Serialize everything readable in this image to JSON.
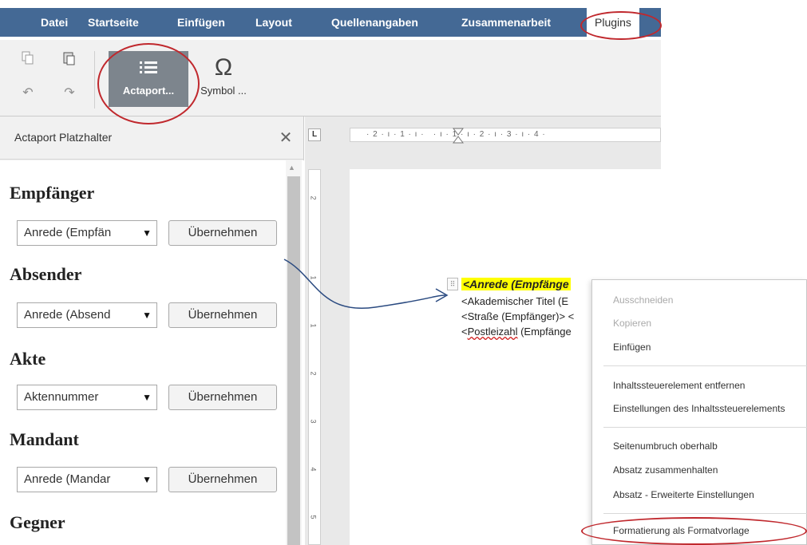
{
  "menubar": {
    "tabs": [
      {
        "label": "Datei"
      },
      {
        "label": "Startseite"
      },
      {
        "label": "Einfügen"
      },
      {
        "label": "Layout"
      },
      {
        "label": "Quellenangaben"
      },
      {
        "label": "Zusammenarbeit"
      },
      {
        "label": "Plugins"
      }
    ],
    "active_tab": "Plugins"
  },
  "toolbar": {
    "copy_icon": "copy-icon",
    "paste_icon": "paste-icon",
    "undo_icon": "undo-icon",
    "redo_icon": "redo-icon",
    "actaport_label": "Actaport...",
    "actaport_icon": "list-icon",
    "symbol_label": "Symbol ...",
    "symbol_icon": "omega-icon"
  },
  "panel": {
    "title": "Actaport Platzhalter",
    "sections": [
      {
        "title": "Empfänger",
        "select": "Anrede (Empfän",
        "button": "Übernehmen"
      },
      {
        "title": "Absender",
        "select": "Anrede (Absend",
        "button": "Übernehmen"
      },
      {
        "title": "Akte",
        "select": "Aktennummer",
        "button": "Übernehmen"
      },
      {
        "title": "Mandant",
        "select": "Anrede (Mandar",
        "button": "Übernehmen"
      },
      {
        "title": "Gegner"
      }
    ]
  },
  "document": {
    "ruler_corner": "L",
    "hruler_marks": "· 2 · ı · 1 · ı ·   · ı · 1 · ı · 2 · ı · 3 · ı · 4 ·",
    "vruler_marks": [
      "2",
      "1",
      "1",
      "2",
      "3",
      "4",
      "5"
    ],
    "lines": [
      "<Anrede (Empfänge",
      "<Akademischer Titel (E",
      "<Straße (Empfänger)> <",
      "<Postleizahl (Empfänge"
    ],
    "line4_prefix": "<",
    "line4_underlined": "Postleizahl",
    "line4_suffix": " (Empfänge"
  },
  "context_menu": {
    "items": [
      {
        "label": "Ausschneiden",
        "enabled": false
      },
      {
        "label": "Kopieren",
        "enabled": false
      },
      {
        "label": "Einfügen",
        "enabled": true
      },
      {
        "label": "Inhaltssteuerelement entfernen",
        "enabled": true
      },
      {
        "label": "Einstellungen des Inhaltssteuerelements",
        "enabled": true
      },
      {
        "label": "Seitenumbruch oberhalb",
        "enabled": true
      },
      {
        "label": "Absatz zusammenhalten",
        "enabled": true
      },
      {
        "label": "Absatz - Erweiterte Einstellungen",
        "enabled": true
      },
      {
        "label": "Formatierung als Formatvorlage",
        "enabled": true
      }
    ]
  },
  "colors": {
    "menubar": "#446995",
    "highlight": "#ffff00",
    "annotation": "#c0282d",
    "arrow": "#2a4a80"
  }
}
